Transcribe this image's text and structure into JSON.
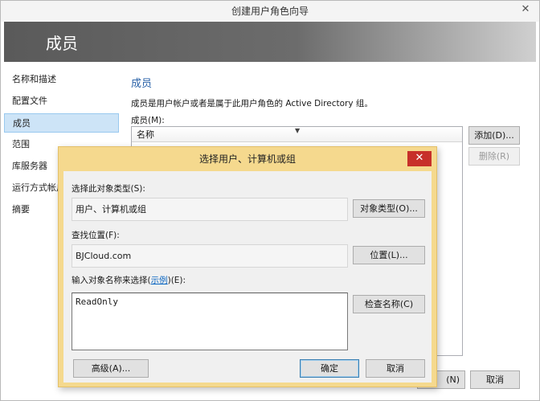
{
  "wizard": {
    "title": "创建用户角色向导",
    "close_glyph": "✕",
    "banner_title": "成员",
    "nav": [
      {
        "label": "名称和描述"
      },
      {
        "label": "配置文件"
      },
      {
        "label": "成员",
        "active": true
      },
      {
        "label": "范围"
      },
      {
        "label": "库服务器"
      },
      {
        "label": "运行方式帐户"
      },
      {
        "label": "摘要"
      }
    ],
    "main": {
      "heading": "成员",
      "description": "成员是用户帐户或者是属于此用户角色的 Active Directory 组。",
      "members_label": "成员(M):",
      "column_name": "名称",
      "add_button": "添加(D)...",
      "remove_button": "删除(R)"
    },
    "footer": {
      "next_button": "(N)",
      "cancel_button": "取消"
    }
  },
  "dialog": {
    "title": "选择用户、计算机或组",
    "close_glyph": "✕",
    "object_types_label": "选择此对象类型(S):",
    "object_types_value": "用户、计算机或组",
    "object_types_button": "对象类型(O)...",
    "location_label": "查找位置(F):",
    "location_value": "BJCloud.com",
    "location_button": "位置(L)...",
    "names_label_prefix": "输入对象名称来选择(",
    "names_label_link": "示例",
    "names_label_suffix": ")(E):",
    "names_value": "ReadOnly",
    "check_names_button": "检查名称(C)",
    "advanced_button": "高级(A)...",
    "ok_button": "确定",
    "cancel_button": "取消"
  },
  "colors": {
    "dialog_frame": "#f5d98e",
    "close_button": "#c7302a",
    "heading": "#2a62a8",
    "nav_active": "#cde4f7"
  }
}
